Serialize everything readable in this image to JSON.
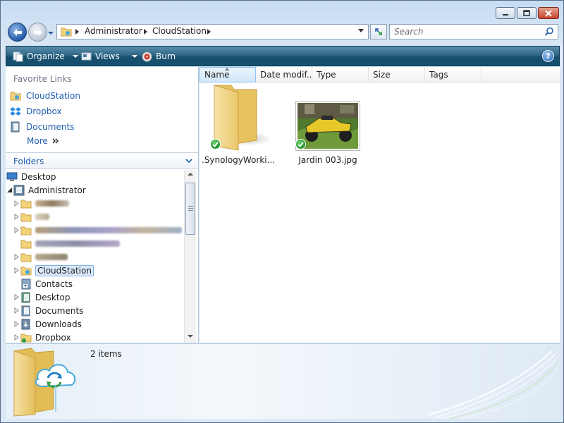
{
  "window": {
    "buttons": {
      "minimize": "minimize",
      "maximize": "maximize",
      "close": "close"
    }
  },
  "address": {
    "crumbs": [
      "Administrator",
      "CloudStation"
    ]
  },
  "search": {
    "placeholder": "Search"
  },
  "toolbar": {
    "organize": "Organize",
    "views": "Views",
    "burn": "Burn",
    "help": "?"
  },
  "favorites": {
    "heading": "Favorite Links",
    "items": [
      {
        "label": "CloudStation",
        "icon": "cloudstation-folder-icon"
      },
      {
        "label": "Dropbox",
        "icon": "dropbox-icon"
      },
      {
        "label": "Documents",
        "icon": "documents-icon"
      }
    ],
    "more": "More"
  },
  "folders": {
    "label": "Folders",
    "tree": [
      {
        "label": "Desktop",
        "icon": "desktop-icon"
      },
      {
        "label": "Administrator",
        "icon": "user-folder-icon"
      },
      {
        "label": "",
        "icon": "folder-icon",
        "blurred": true
      },
      {
        "label": "",
        "icon": "folder-icon",
        "blurred": true
      },
      {
        "label": "",
        "icon": "folder-icon",
        "blurred": true
      },
      {
        "label": "",
        "icon": "folder-icon",
        "blurred": true
      },
      {
        "label": "",
        "icon": "folder-icon",
        "blurred": true
      },
      {
        "label": "CloudStation",
        "icon": "cloudstation-folder-icon",
        "selected": true
      },
      {
        "label": "Contacts",
        "icon": "contacts-icon"
      },
      {
        "label": "Desktop",
        "icon": "desktop-folder-icon"
      },
      {
        "label": "Documents",
        "icon": "documents-icon"
      },
      {
        "label": "Downloads",
        "icon": "downloads-icon"
      },
      {
        "label": "Dropbox",
        "icon": "dropbox-icon"
      }
    ]
  },
  "columns": [
    "Name",
    "Date modif...",
    "Type",
    "Size",
    "Tags"
  ],
  "files": [
    {
      "label": ".SynologyWorki...",
      "icon": "folder-icon",
      "synced": true
    },
    {
      "label": "Jardin 003.jpg",
      "icon": "photo-thumbnail-icon",
      "synced": true
    }
  ],
  "details": {
    "count": "2 items"
  },
  "colors": {
    "link": "#1f5fae",
    "toolbar": "#184e6e",
    "folder": "#f3d27a"
  }
}
